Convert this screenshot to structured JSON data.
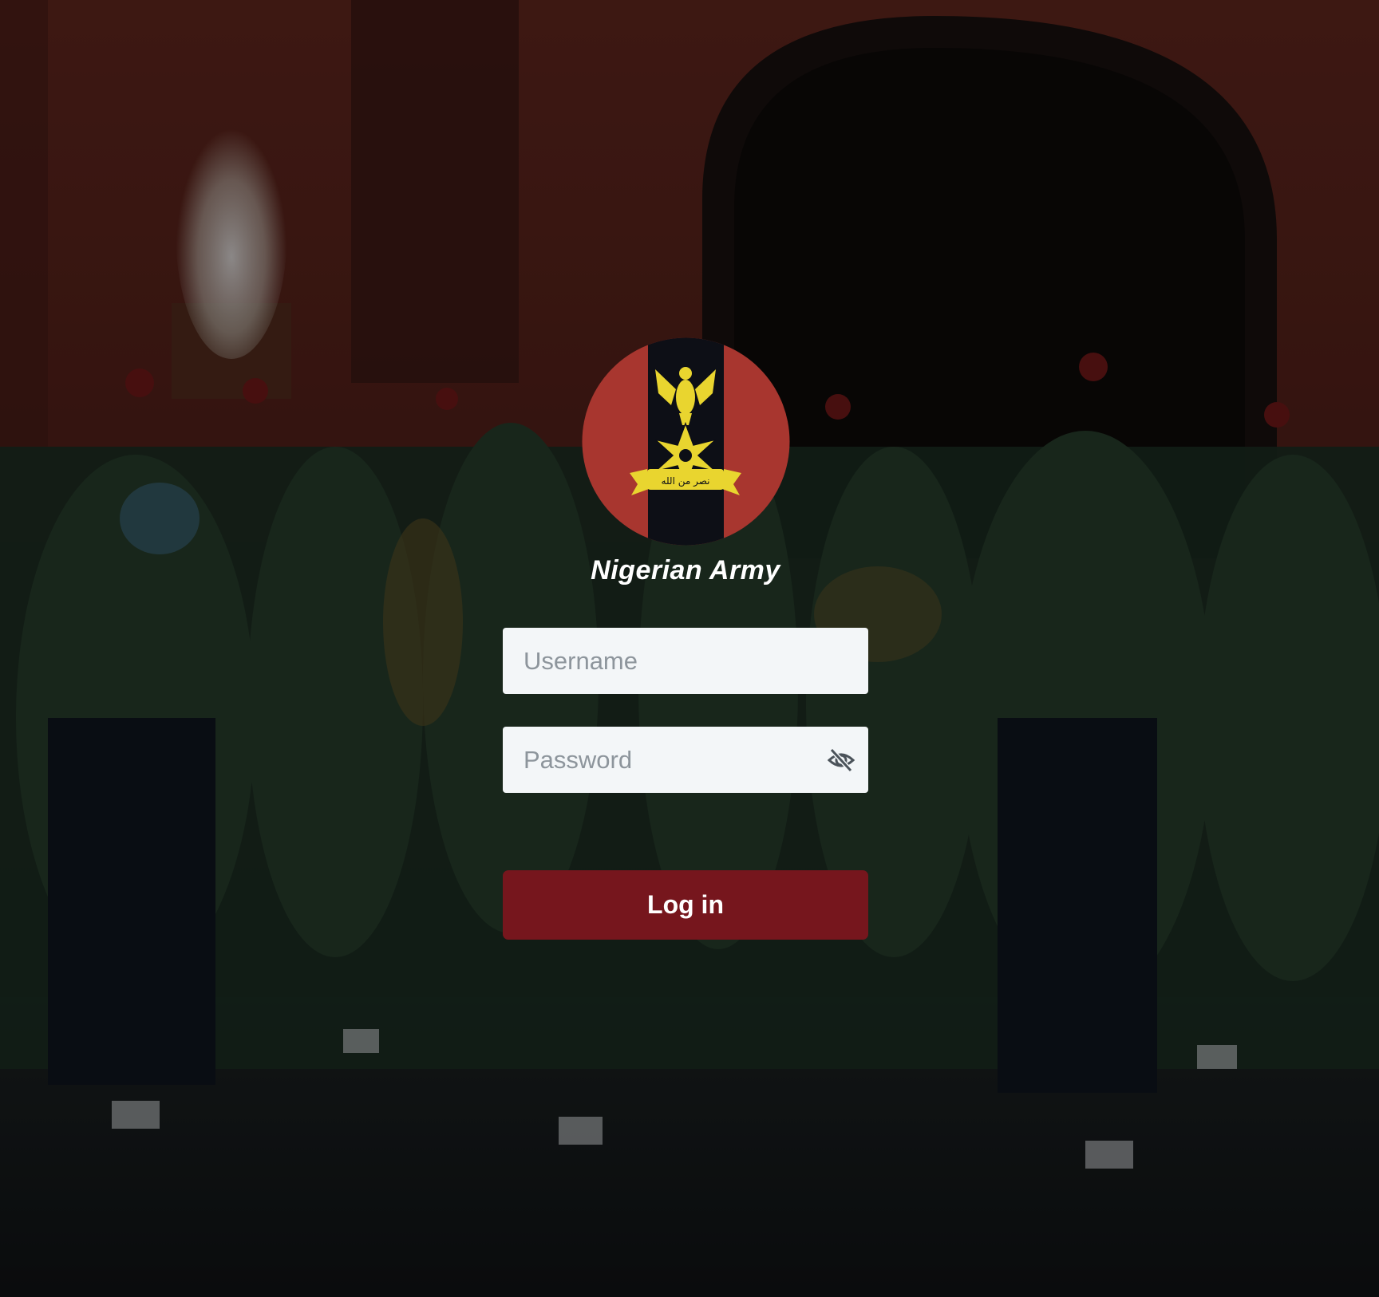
{
  "brand": {
    "logo_icon": "nigerian-army-crest-icon",
    "logo_colors": {
      "outer": "#a8362f",
      "band": "#0d0f16",
      "emblem": "#e9d52f"
    },
    "name": "Nigerian Army"
  },
  "form": {
    "username": {
      "placeholder": "Username",
      "value": ""
    },
    "password": {
      "placeholder": "Password",
      "value": "",
      "toggle_icon": "eye-slash-icon"
    },
    "submit_label": "Log in"
  },
  "colors": {
    "button": "#76161d",
    "input_bg": "#f3f6f8",
    "placeholder": "#8d959c"
  }
}
